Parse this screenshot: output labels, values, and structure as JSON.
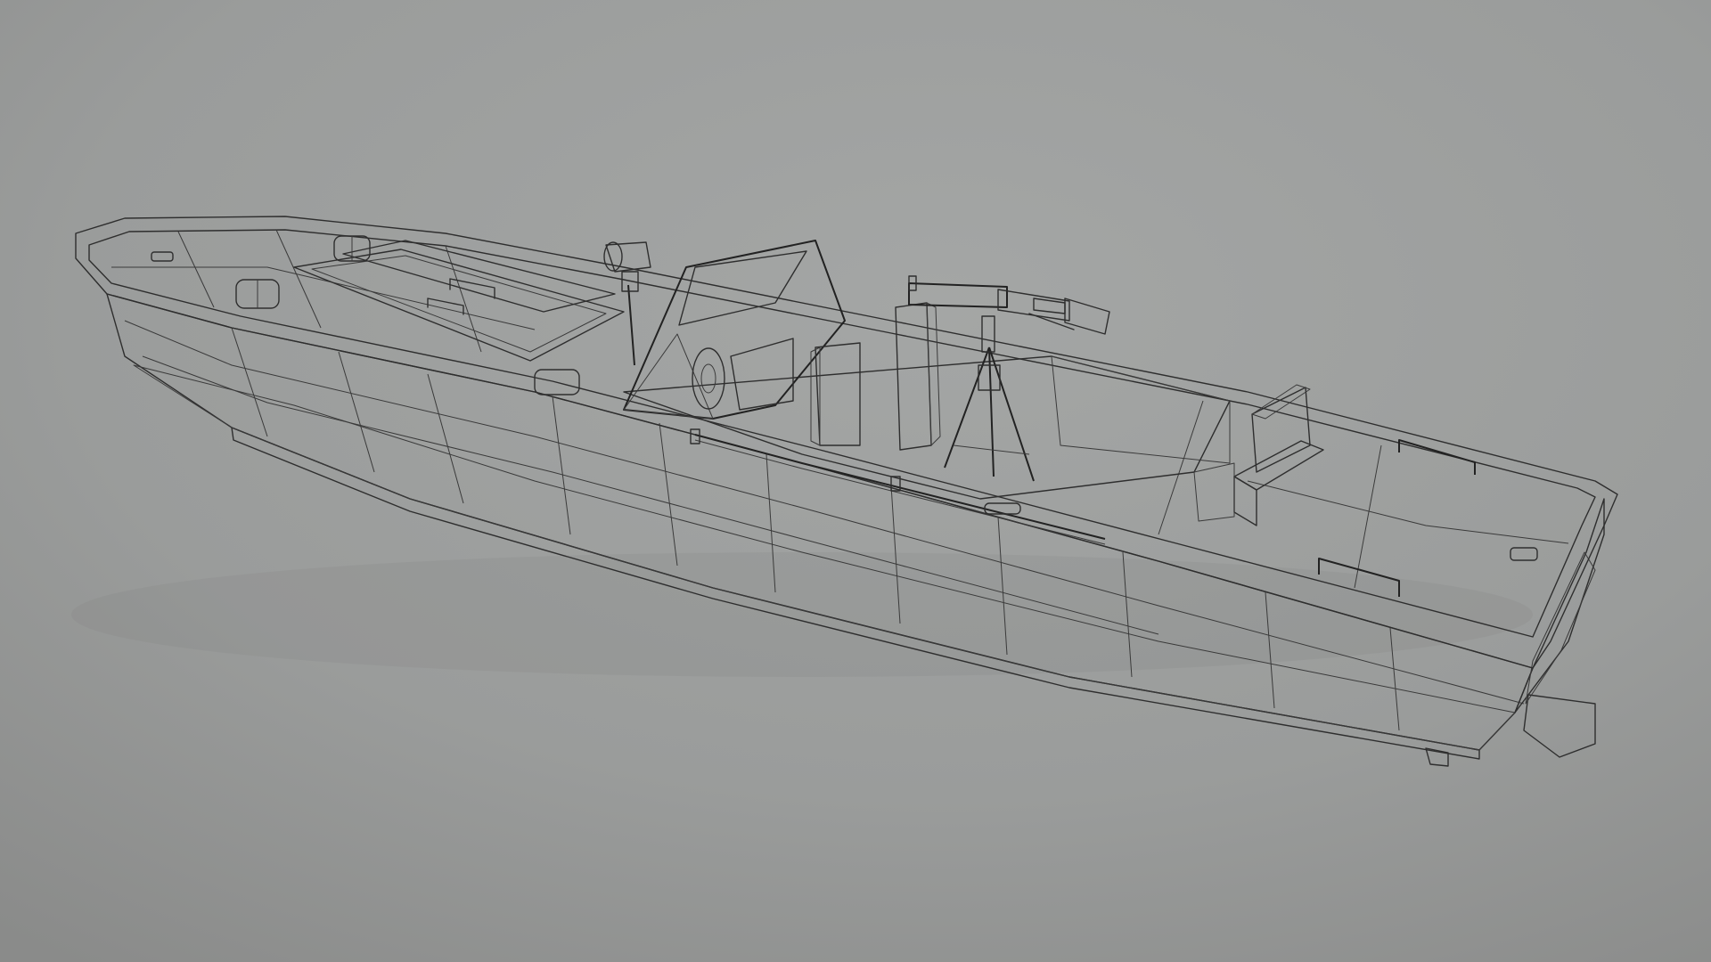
{
  "scene": {
    "colors": {
      "background_light": "#a4a6a5",
      "background_mid": "#9a9c9b",
      "background_dark": "#8a8b8a",
      "hull_side": "#a3a4a3",
      "hull_lower": "#8f908f",
      "hull_keel": "#3f4040",
      "deck": "#9c9d9c",
      "deck_light": "#a9aaa9",
      "dark_panel": "#3a3a3a",
      "cabin_panel": "#b0b1b0",
      "wire": "#2e2e2e"
    },
    "model_parts": [
      "hull",
      "bow-deck",
      "hatch-cover",
      "searchlight",
      "windshield",
      "seats",
      "machine-gun",
      "tripod-mount",
      "stern-bench",
      "rudder",
      "handrails",
      "cleats"
    ]
  }
}
